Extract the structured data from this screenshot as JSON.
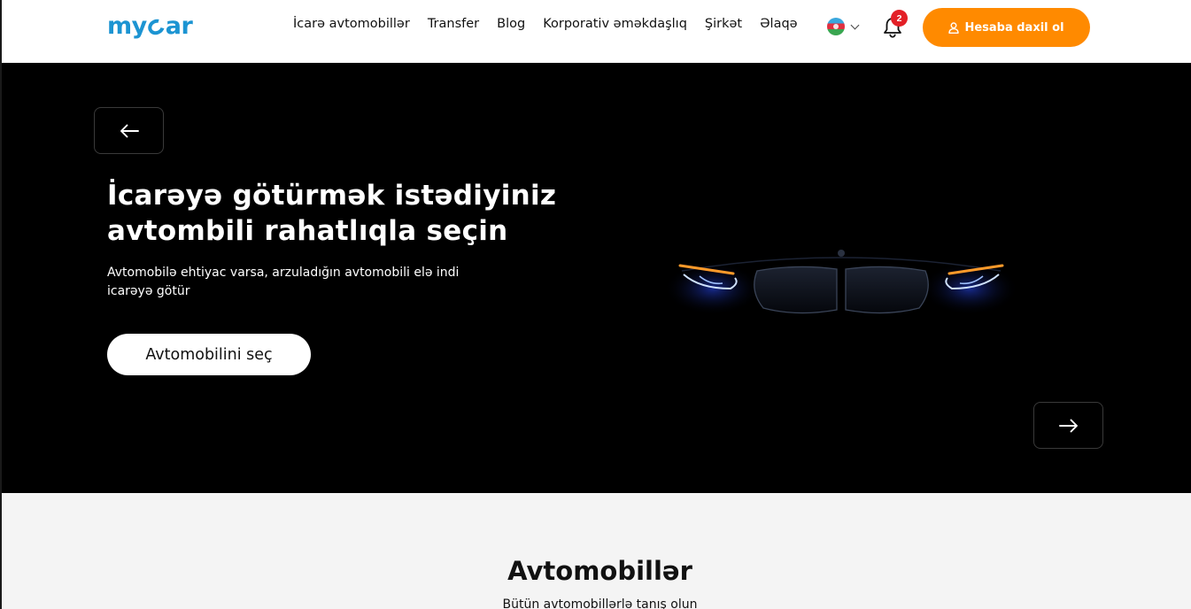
{
  "header": {
    "logo_text_left": "my",
    "logo_text_right": "ar",
    "nav": [
      {
        "label": "İcarə avtomobillər"
      },
      {
        "label": "Transfer"
      },
      {
        "label": "Blog"
      },
      {
        "label": "Korporativ əməkdaşlıq"
      },
      {
        "label": "Şirkət"
      },
      {
        "label": "Əlaqə"
      }
    ],
    "language_flag": "azerbaijan-flag-icon",
    "notifications_count": "2",
    "login_label": "Hesaba daxil ol"
  },
  "hero": {
    "title": "İcarəyə götürmək istədiyiniz avtombili rahatlıqla seçin",
    "subtitle": "Avtomobilə ehtiyac varsa, arzuladığın avtomobili elə indi icarəyə götür",
    "cta_label": "Avtomobilini seç",
    "prev_icon": "arrow-left-icon",
    "next_icon": "arrow-right-icon"
  },
  "section": {
    "title": "Avtomobillər",
    "subtitle": "Bütün avtomobillərlə tanış olun"
  },
  "colors": {
    "brand_blue": "#1c94d2",
    "accent_orange": "#ff8a00",
    "badge_red": "#e32027",
    "hero_bg": "#000000",
    "section_bg": "#f4f4f4"
  }
}
